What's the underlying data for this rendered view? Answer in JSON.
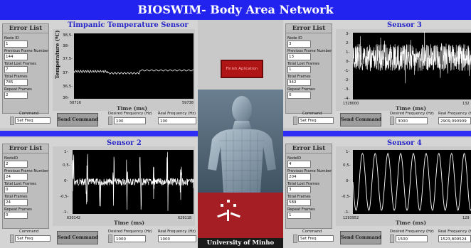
{
  "app": {
    "title": "BIOSWIM- Body Area Network"
  },
  "center": {
    "stop_label": "Finish Aplication",
    "university": "University of Minho",
    "model_image": "anatomical-body-icon",
    "logo_image": "university-logo-icon"
  },
  "common": {
    "error_list": "Error List",
    "send_command": "Send Command",
    "desired_freq": "Desired Frequency (Hz)",
    "real_freq": "Real Frequency (Hz)",
    "command": "Command",
    "time_label": "Time (ms)"
  },
  "panels": {
    "temp": {
      "title": "Timpanic Temperature Sensor",
      "node_label": "Node ID",
      "node": "1",
      "prev_label": "Previous Frame Number",
      "prev": "144",
      "lost_label": "Total Lost Frames",
      "lost": "7",
      "total_label": "Total Frames",
      "total": "785",
      "repeat_label": "Repeat Frames",
      "repeat": "2",
      "command_value": "Set Freq",
      "desired": "100",
      "real": "100",
      "ylabel": "Temperature (ºC)",
      "yticks": [
        "38,5-",
        "38-",
        "37,5-",
        "37-",
        "36,5-",
        "36-"
      ],
      "xticks": [
        "58716",
        "59738"
      ]
    },
    "s2": {
      "title": "Sensor 2",
      "node_label": "NodeID",
      "node": "2",
      "prev_label": "Previous Frame Number",
      "prev": "24",
      "lost_label": "Total Lost Frames",
      "lost": "0",
      "total_label": "Total Frames",
      "total": "24",
      "repeat_label": "Repeat Frames",
      "repeat": "0",
      "command_value": "Set Freq",
      "desired": "1000",
      "real": "1000",
      "yticks": [
        "1-",
        "0,5-",
        "0-",
        "-0,5-",
        "-1-"
      ],
      "xticks": [
        "630142",
        "629118"
      ]
    },
    "s3": {
      "title": "Sensor 3",
      "node_label": "Node ID",
      "node": "3",
      "prev_label": "Previous Frame Number",
      "prev": "13",
      "lost_label": "Total Lost Frames",
      "lost": "1",
      "total_label": "Total Frames",
      "total": "342",
      "repeat_label": "Repeat Frames",
      "repeat": "0",
      "command_value": "Set Freq",
      "desired": "3000",
      "real": "2909,090909",
      "yticks": [
        "3-",
        "2-",
        "1-",
        "0-",
        "-1-",
        "-2-",
        "-3-",
        "-4-"
      ],
      "xticks": [
        "1328000",
        "132"
      ]
    },
    "s4": {
      "title": "Sensor 4",
      "node_label": "NodeID",
      "node": "4",
      "prev_label": "Previous Frame Number",
      "prev": "204",
      "lost_label": "Total Lost Frames",
      "lost": "3",
      "total_label": "Total Frames",
      "total": "589",
      "repeat_label": "Repeat Frames",
      "repeat": "1",
      "command_value": "Set Freq",
      "desired": "1500",
      "real": "1523,809524",
      "yticks": [
        "1-",
        "0,5-",
        "0-",
        "-0,5-",
        "-1-"
      ],
      "xticks": [
        "1293952",
        "129"
      ]
    }
  },
  "colors": {
    "title_bar": "#2323f0",
    "plot_bg": "#000000",
    "trace": "#ffffff",
    "stop": "#b01515",
    "logo": "#a41e23"
  }
}
